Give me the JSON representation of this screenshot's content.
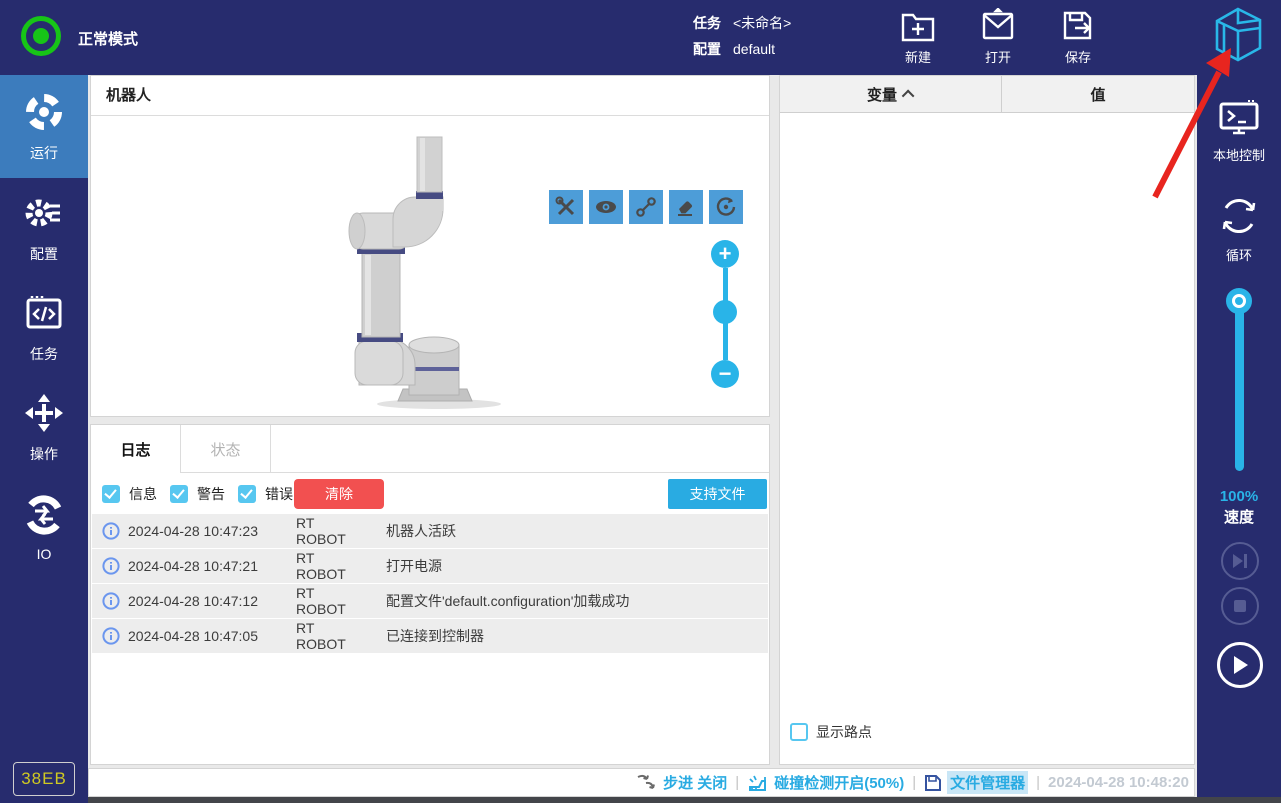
{
  "top_bar": {
    "mode_label": "正常模式",
    "task_label": "任务",
    "task_value": "<未命名>",
    "config_label": "配置",
    "config_value": "default",
    "actions": [
      {
        "label": "新建",
        "icon": "new-folder-plus-icon"
      },
      {
        "label": "打开",
        "icon": "open-envelope-icon"
      },
      {
        "label": "保存",
        "icon": "save-export-icon"
      }
    ],
    "logo_icon": "brand-cube-logo"
  },
  "left_sidebar": {
    "items": [
      {
        "label": "运行",
        "icon": "run-target-icon",
        "active": true
      },
      {
        "label": "配置",
        "icon": "config-gear-icon",
        "active": false
      },
      {
        "label": "任务",
        "icon": "task-code-icon",
        "active": false
      },
      {
        "label": "操作",
        "icon": "operate-move-icon",
        "active": false
      },
      {
        "label": "IO",
        "icon": "io-exchange-icon",
        "active": false
      }
    ],
    "badge": "38EB"
  },
  "robot_panel": {
    "title": "机器人",
    "toolbar_icons": [
      "tools-icon",
      "eye-icon",
      "path-waypoints-icon",
      "eraser-icon",
      "rotate-view-icon"
    ],
    "zoom_in": "+",
    "zoom_out": "−"
  },
  "log_panel": {
    "tabs": [
      {
        "label": "日志",
        "active": true
      },
      {
        "label": "状态",
        "active": false
      }
    ],
    "filters": [
      {
        "label": "信息",
        "checked": true
      },
      {
        "label": "警告",
        "checked": true
      },
      {
        "label": "错误",
        "checked": true
      }
    ],
    "clear_button": "清除",
    "support_button": "支持文件",
    "entries": [
      {
        "time": "2024-04-28 10:47:23",
        "source": "RT ROBOT",
        "message": "机器人活跃"
      },
      {
        "time": "2024-04-28 10:47:21",
        "source": "RT ROBOT",
        "message": "打开电源"
      },
      {
        "time": "2024-04-28 10:47:12",
        "source": "RT ROBOT",
        "message": "配置文件'default.configuration'加载成功"
      },
      {
        "time": "2024-04-28 10:47:05",
        "source": "RT ROBOT",
        "message": "已连接到控制器"
      }
    ]
  },
  "variable_panel": {
    "columns": [
      {
        "label": "变量",
        "sort": "asc"
      },
      {
        "label": "值"
      }
    ],
    "rows": [],
    "show_waypoints_label": "显示路点",
    "show_waypoints_checked": false
  },
  "right_sidebar": {
    "local_control_label": "本地控制",
    "loop_label": "循环",
    "speed_value": "100%",
    "speed_label": "速度",
    "playback_icons": [
      "skip-next-icon",
      "stop-icon",
      "play-icon"
    ]
  },
  "status_bar": {
    "step_label": "步进 关闭",
    "collision_label": "碰撞检测开启(50%)",
    "file_manager_label": "文件管理器",
    "timestamp": "2024-04-28 10:48:20",
    "separator": "|"
  },
  "colors": {
    "navy": "#272c6e",
    "active_blue": "#3c7cbd",
    "toolbar_blue": "#4d9dd8",
    "cyan": "#29b4e8",
    "accent_blue": "#29abe2",
    "red": "#f25050",
    "green": "#17c417",
    "badge_yellow": "#cfc922",
    "arrow_red": "#e8251f"
  }
}
